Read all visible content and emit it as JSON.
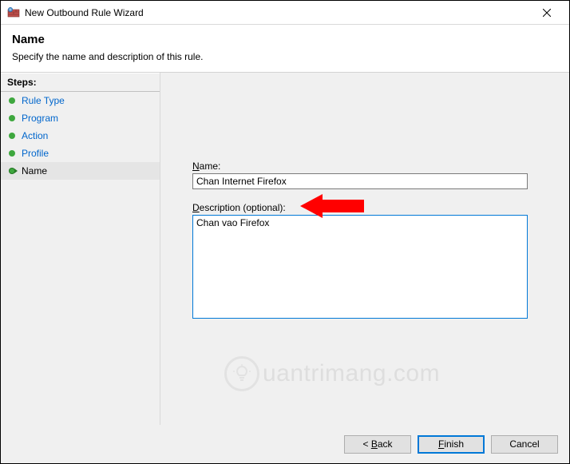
{
  "window": {
    "title": "New Outbound Rule Wizard",
    "close_label": "Close"
  },
  "header": {
    "title": "Name",
    "subtitle": "Specify the name and description of this rule."
  },
  "sidebar": {
    "header": "Steps:",
    "items": [
      {
        "label": "Rule Type",
        "current": false
      },
      {
        "label": "Program",
        "current": false
      },
      {
        "label": "Action",
        "current": false
      },
      {
        "label": "Profile",
        "current": false
      },
      {
        "label": "Name",
        "current": true
      }
    ]
  },
  "form": {
    "name_label_prefix": "N",
    "name_label_rest": "ame:",
    "name_value": "Chan Internet Firefox",
    "desc_label_prefix": "D",
    "desc_label_rest": "escription (optional):",
    "desc_value": "Chan vao Firefox"
  },
  "footer": {
    "back_prefix": "< ",
    "back_u": "B",
    "back_rest": "ack",
    "finish_u": "F",
    "finish_rest": "inish",
    "cancel": "Cancel"
  },
  "watermark": {
    "text": "uantrimang.com"
  }
}
